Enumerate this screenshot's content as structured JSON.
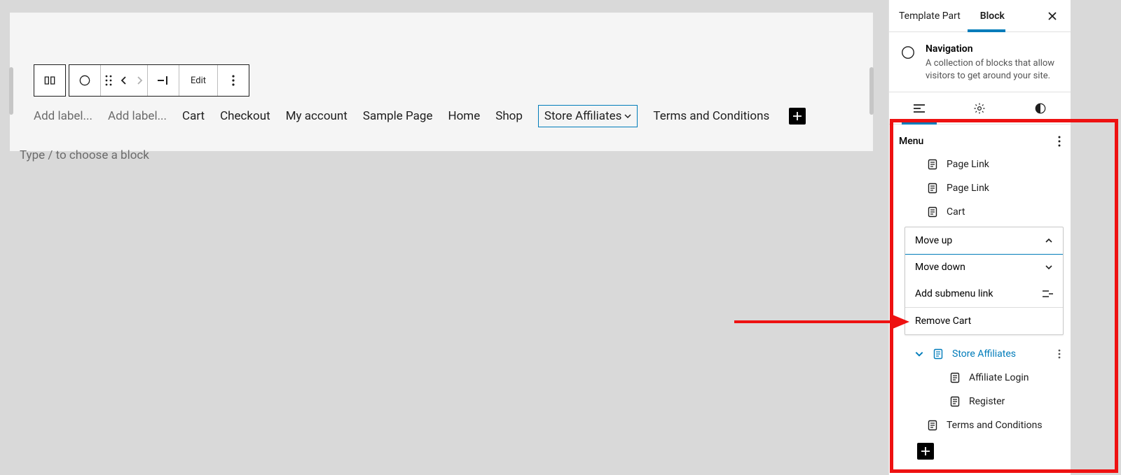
{
  "toolbar": {
    "edit_label": "Edit"
  },
  "nav": {
    "placeholder_1": "Add label...",
    "placeholder_2": "Add label...",
    "items": [
      "Cart",
      "Checkout",
      "My account",
      "Sample Page",
      "Home",
      "Shop"
    ],
    "selected": "Store Affiliates",
    "trailing": "Terms and Conditions"
  },
  "canvas": {
    "slash_hint": "Type / to choose a block"
  },
  "inspector": {
    "tabs": {
      "template_part": "Template Part",
      "block": "Block"
    },
    "block": {
      "title": "Navigation",
      "desc": "A collection of blocks that allow visitors to get around your site."
    },
    "panel_title": "Menu",
    "menu": {
      "page_link_1": "Page Link",
      "page_link_2": "Page Link",
      "cart": "Cart",
      "store_affiliates": "Store Affiliates",
      "affiliate_login": "Affiliate Login",
      "register": "Register",
      "terms": "Terms and Conditions"
    },
    "ctx": {
      "move_up": "Move up",
      "move_down": "Move down",
      "add_sub": "Add submenu link",
      "remove": "Remove Cart"
    }
  }
}
